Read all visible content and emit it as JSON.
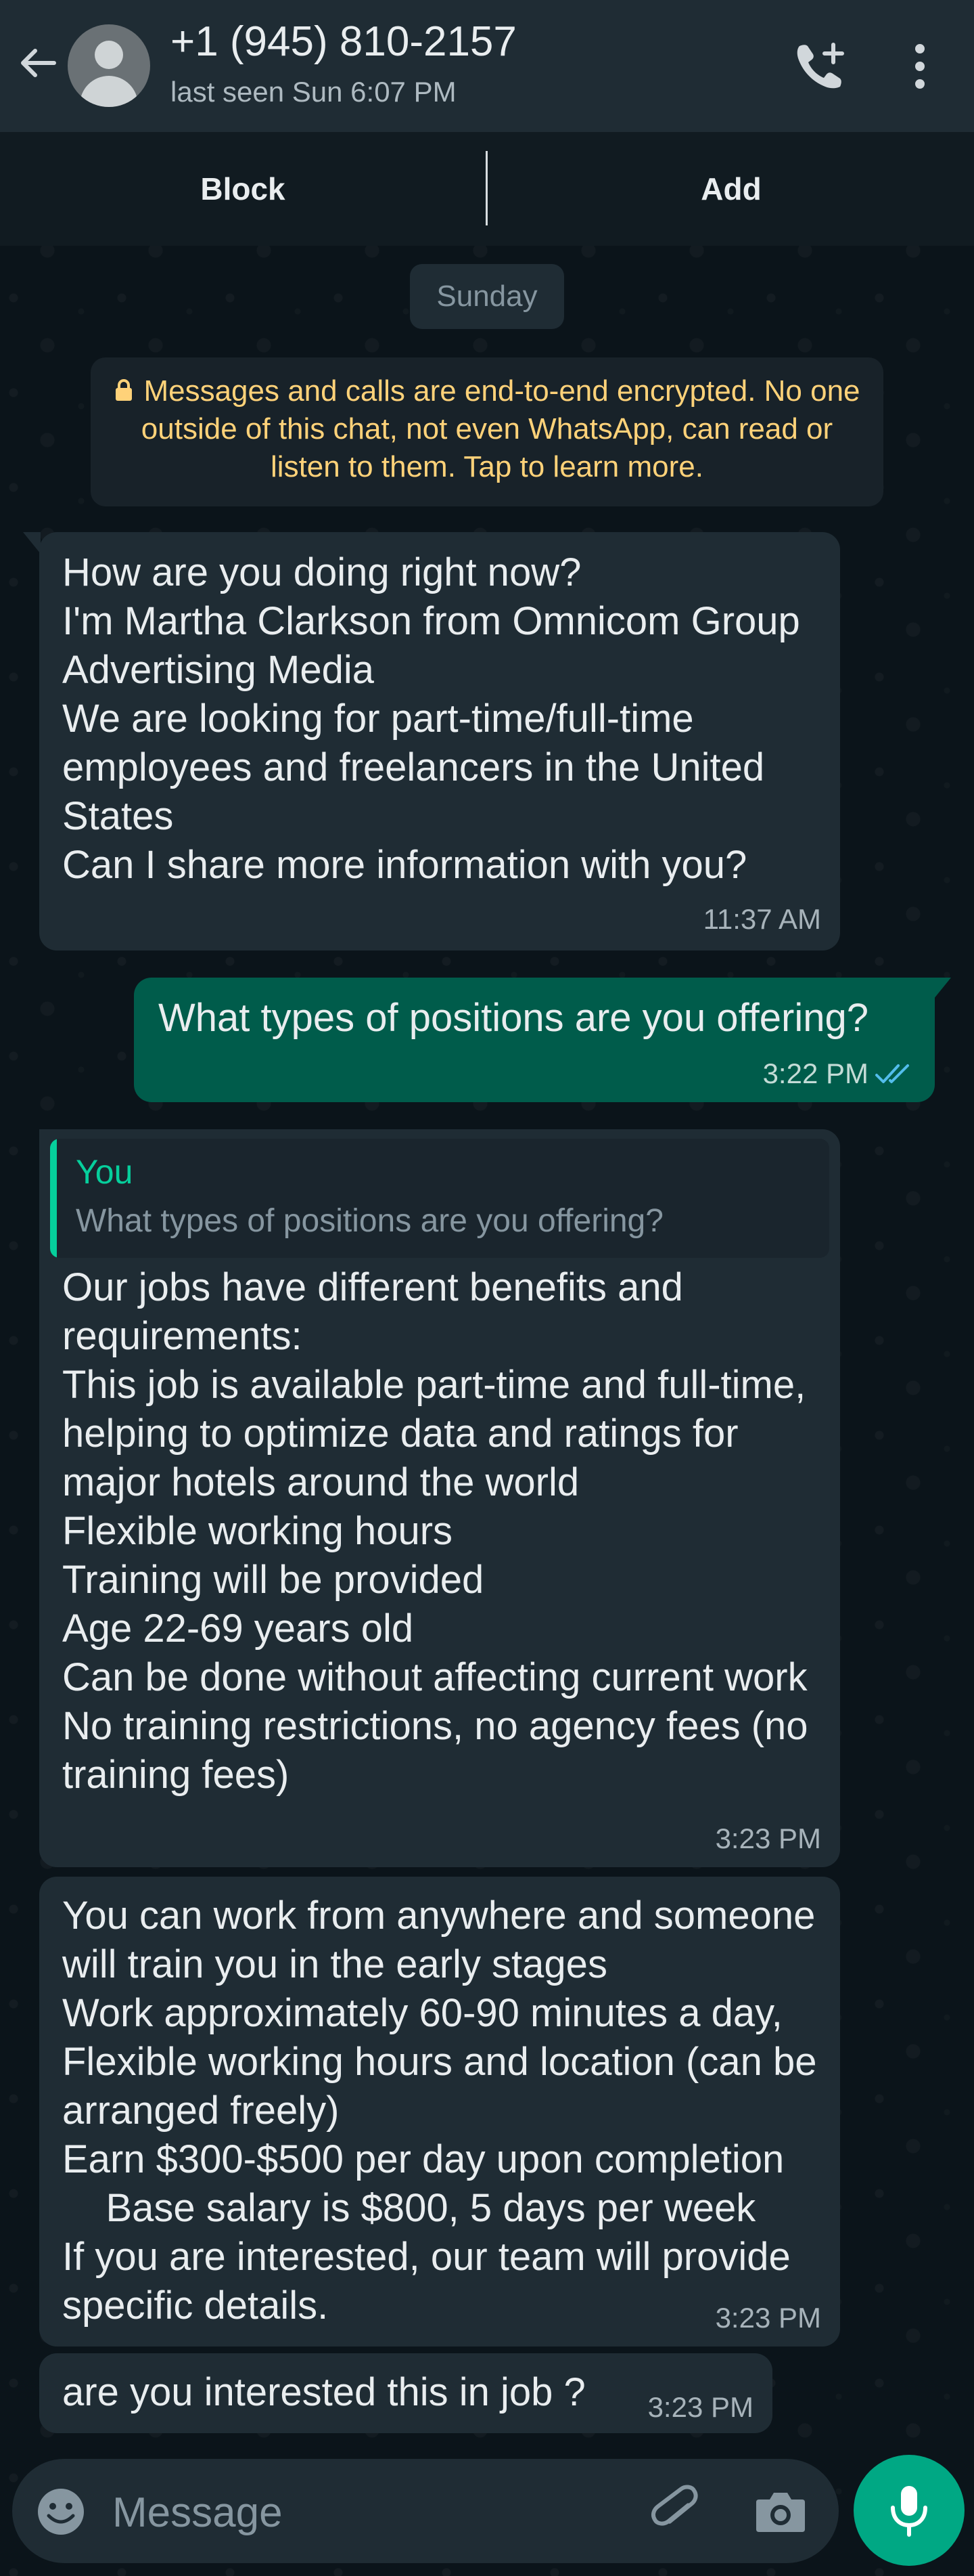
{
  "header": {
    "contact": "+1 (945) 810-2157",
    "status": "last seen Sun 6:07 PM",
    "icons": [
      "back-arrow-icon",
      "avatar",
      "add-call-icon",
      "more-options-icon"
    ]
  },
  "actions": {
    "block": "Block",
    "add": "Add"
  },
  "date_separator": "Sunday",
  "encryption_notice": "Messages and calls are end-to-end encrypted. No one outside of this chat, not even WhatsApp, can read or listen to them. Tap to learn more.",
  "messages": [
    {
      "direction": "incoming",
      "text": "How are you doing right now?\nI'm Martha Clarkson from Omnicom Group Advertising Media\nWe are looking for part-time/full-time employees and freelancers in the United States\nCan I share more information with you?",
      "time": "11:37 AM"
    },
    {
      "direction": "outgoing",
      "text": "What types of positions are you offering?",
      "time": "3:22 PM",
      "status": "read"
    },
    {
      "direction": "incoming",
      "reply_to": {
        "author": "You",
        "text": "What types of positions are you offering?"
      },
      "text": "Our jobs have different benefits and requirements:\nThis job is available part-time and full-time, helping to optimize data and ratings for major hotels around the world\nFlexible working hours\nTraining will be provided\nAge 22-69 years old\nCan be done without affecting current work\nNo training restrictions, no agency fees (no training fees)",
      "time": "3:23 PM"
    },
    {
      "direction": "incoming",
      "text": "You can work from anywhere and someone will train you in the early stages\nWork approximately 60-90 minutes a day, Flexible working hours and location (can be arranged freely)\nEarn $300-$500 per day upon completion\n    Base salary is $800, 5 days per week\nIf you are interested, our team will provide specific details.",
      "time": "3:23 PM"
    },
    {
      "direction": "incoming",
      "text": "are you interested this in job ?",
      "time": "3:23 PM"
    }
  ],
  "composer": {
    "placeholder": "Message",
    "icons": [
      "emoji-icon",
      "attach-icon",
      "camera-icon",
      "mic-icon"
    ]
  },
  "colors": {
    "header_bg": "#1f2c34",
    "chat_bg": "#0b141a",
    "incoming_bubble": "#1f2c34",
    "outgoing_bubble": "#005c4b",
    "accent": "#00a884",
    "encryption_text": "#ffd279",
    "read_ticks": "#53bdeb"
  }
}
